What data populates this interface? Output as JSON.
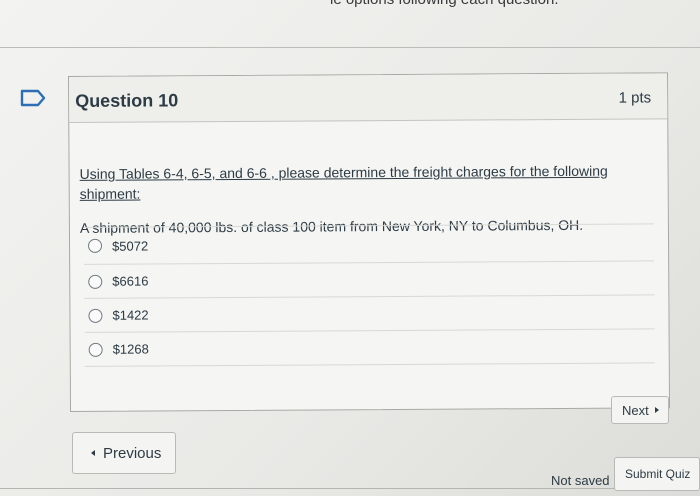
{
  "header": {
    "instruction_fragment": "ie options following each question."
  },
  "question": {
    "title": "Question 10",
    "points": "1 pts",
    "prompt_line1": "Using Tables 6-4, 6-5, and 6-6 , please determine the freight charges for the following shipment:",
    "prompt_line2": "A shipment of 40,000 lbs. of class 100 item from New York, NY to Columbus, OH.",
    "answers": [
      {
        "label": "$5072"
      },
      {
        "label": "$6616"
      },
      {
        "label": "$1422"
      },
      {
        "label": "$1268"
      }
    ],
    "icon": "bookmark-flag-icon"
  },
  "navigation": {
    "next_label": "Next",
    "previous_label": "Previous"
  },
  "footer": {
    "status": "Not saved",
    "submit_label": "Submit Quiz"
  },
  "colors": {
    "accent": "#2d3b45",
    "background": "#f3f3f1"
  }
}
